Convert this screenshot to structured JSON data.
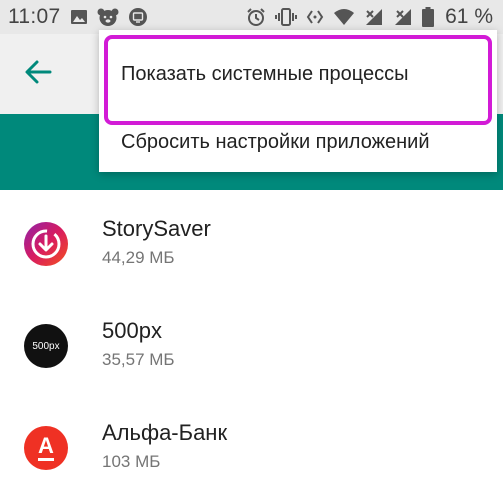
{
  "status_bar": {
    "time": "11:07",
    "battery_percent": "61 %",
    "left_icons": [
      "image-icon",
      "bear-icon",
      "cast-icon"
    ],
    "right_icons": [
      "alarm-icon",
      "vibrate-icon",
      "code-icon",
      "wifi-icon",
      "signal-no-data-icon",
      "signal-icon",
      "battery-icon"
    ]
  },
  "toolbar": {
    "back_icon": "arrow-left-icon",
    "accent_color": "#00897b"
  },
  "menu": {
    "items": [
      {
        "label": "Показать системные процессы",
        "highlighted": true
      },
      {
        "label": "Сбросить настройки приложений",
        "highlighted": false
      }
    ],
    "highlight_color": "#d21bd6"
  },
  "apps": [
    {
      "name": "StorySaver",
      "size": "44,29 МБ",
      "icon": "storysaver-icon"
    },
    {
      "name": "500px",
      "size": "35,57 МБ",
      "icon": "500px-icon",
      "icon_text": "500px"
    },
    {
      "name": "Альфа-Банк",
      "size": "103 МБ",
      "icon": "alfa-bank-icon",
      "icon_text": "А"
    }
  ]
}
